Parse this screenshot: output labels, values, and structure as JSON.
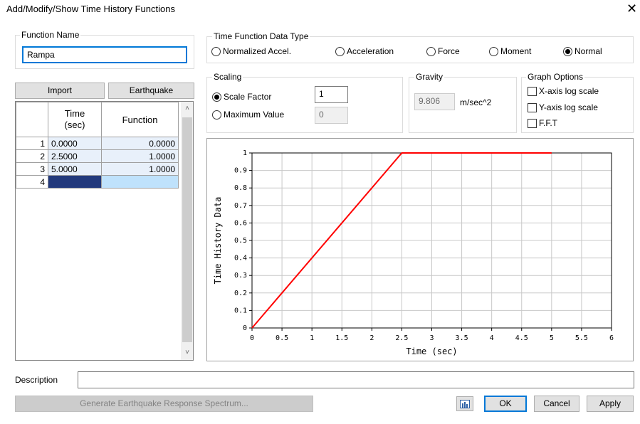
{
  "window": {
    "title": "Add/Modify/Show Time History Functions",
    "close_glyph": "✕"
  },
  "function_name": {
    "label": "Function Name",
    "value": "Rampa"
  },
  "buttons": {
    "import": "Import",
    "earthquake": "Earthquake",
    "generate": "Generate Earthquake Response Spectrum...",
    "ok": "OK",
    "cancel": "Cancel",
    "apply": "Apply",
    "graph_icon": "chart-icon"
  },
  "table": {
    "headers": [
      "Time\n(sec)",
      "Function"
    ],
    "rows": [
      {
        "n": "1",
        "time": "0.0000",
        "func": "0.0000"
      },
      {
        "n": "2",
        "time": "2.5000",
        "func": "1.0000"
      },
      {
        "n": "3",
        "time": "5.0000",
        "func": "1.0000"
      },
      {
        "n": "4",
        "time": "",
        "func": ""
      }
    ]
  },
  "data_type": {
    "label": "Time Function Data Type",
    "options": [
      "Normalized Accel.",
      "Acceleration",
      "Force",
      "Moment",
      "Normal"
    ],
    "selected": "Normal"
  },
  "scaling": {
    "label": "Scaling",
    "scale_factor_label": "Scale Factor",
    "scale_factor_value": "1",
    "max_value_label": "Maximum Value",
    "max_value_value": "0",
    "selected": "Scale Factor"
  },
  "gravity": {
    "label": "Gravity",
    "value": "9.806",
    "unit": "m/sec^2"
  },
  "graph_options": {
    "label": "Graph Options",
    "x_log": "X-axis log scale",
    "y_log": "Y-axis log scale",
    "fft": "F.F.T"
  },
  "description": {
    "label": "Description",
    "value": ""
  },
  "chart_data": {
    "type": "line",
    "xlabel": "Time (sec)",
    "ylabel": "Time History Data",
    "xlim": [
      0,
      6
    ],
    "ylim": [
      0,
      1
    ],
    "xticks": [
      "0",
      "0.5",
      "1",
      "1.5",
      "2",
      "2.5",
      "3",
      "3.5",
      "4",
      "4.5",
      "5",
      "5.5",
      "6"
    ],
    "yticks": [
      "0",
      "0.1",
      "0.2",
      "0.3",
      "0.4",
      "0.5",
      "0.6",
      "0.7",
      "0.8",
      "0.9",
      "1"
    ],
    "grid": true,
    "series": [
      {
        "color": "#ff0000",
        "x": [
          0,
          2.5,
          5
        ],
        "y": [
          0,
          1,
          1
        ]
      }
    ]
  }
}
